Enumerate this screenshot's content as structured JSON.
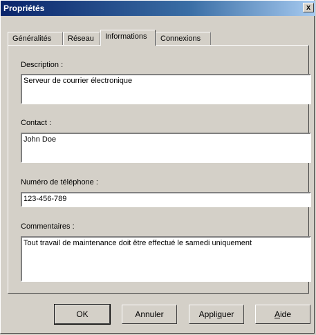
{
  "window": {
    "title": "Propriétés",
    "close_glyph": "x"
  },
  "tabs": [
    {
      "label": "Généralités"
    },
    {
      "label": "Réseau"
    },
    {
      "label": "Informations"
    },
    {
      "label": "Connexions"
    }
  ],
  "active_tab": "Informations",
  "form": {
    "description": {
      "label": "Description :",
      "value": "Serveur de courrier électronique"
    },
    "contact": {
      "label": "Contact :",
      "value": "John Doe"
    },
    "phone": {
      "label": "Numéro de téléphone :",
      "value": "123-456-789"
    },
    "comments": {
      "label": "Commentaires :",
      "value": "Tout travail de maintenance doit être effectué le samedi uniquement"
    }
  },
  "buttons": {
    "ok": "OK",
    "cancel": "Annuler",
    "apply_prefix": "Appli",
    "apply_mnemonic": "q",
    "apply_suffix": "uer",
    "help_mnemonic": "A",
    "help_suffix": "ide"
  }
}
